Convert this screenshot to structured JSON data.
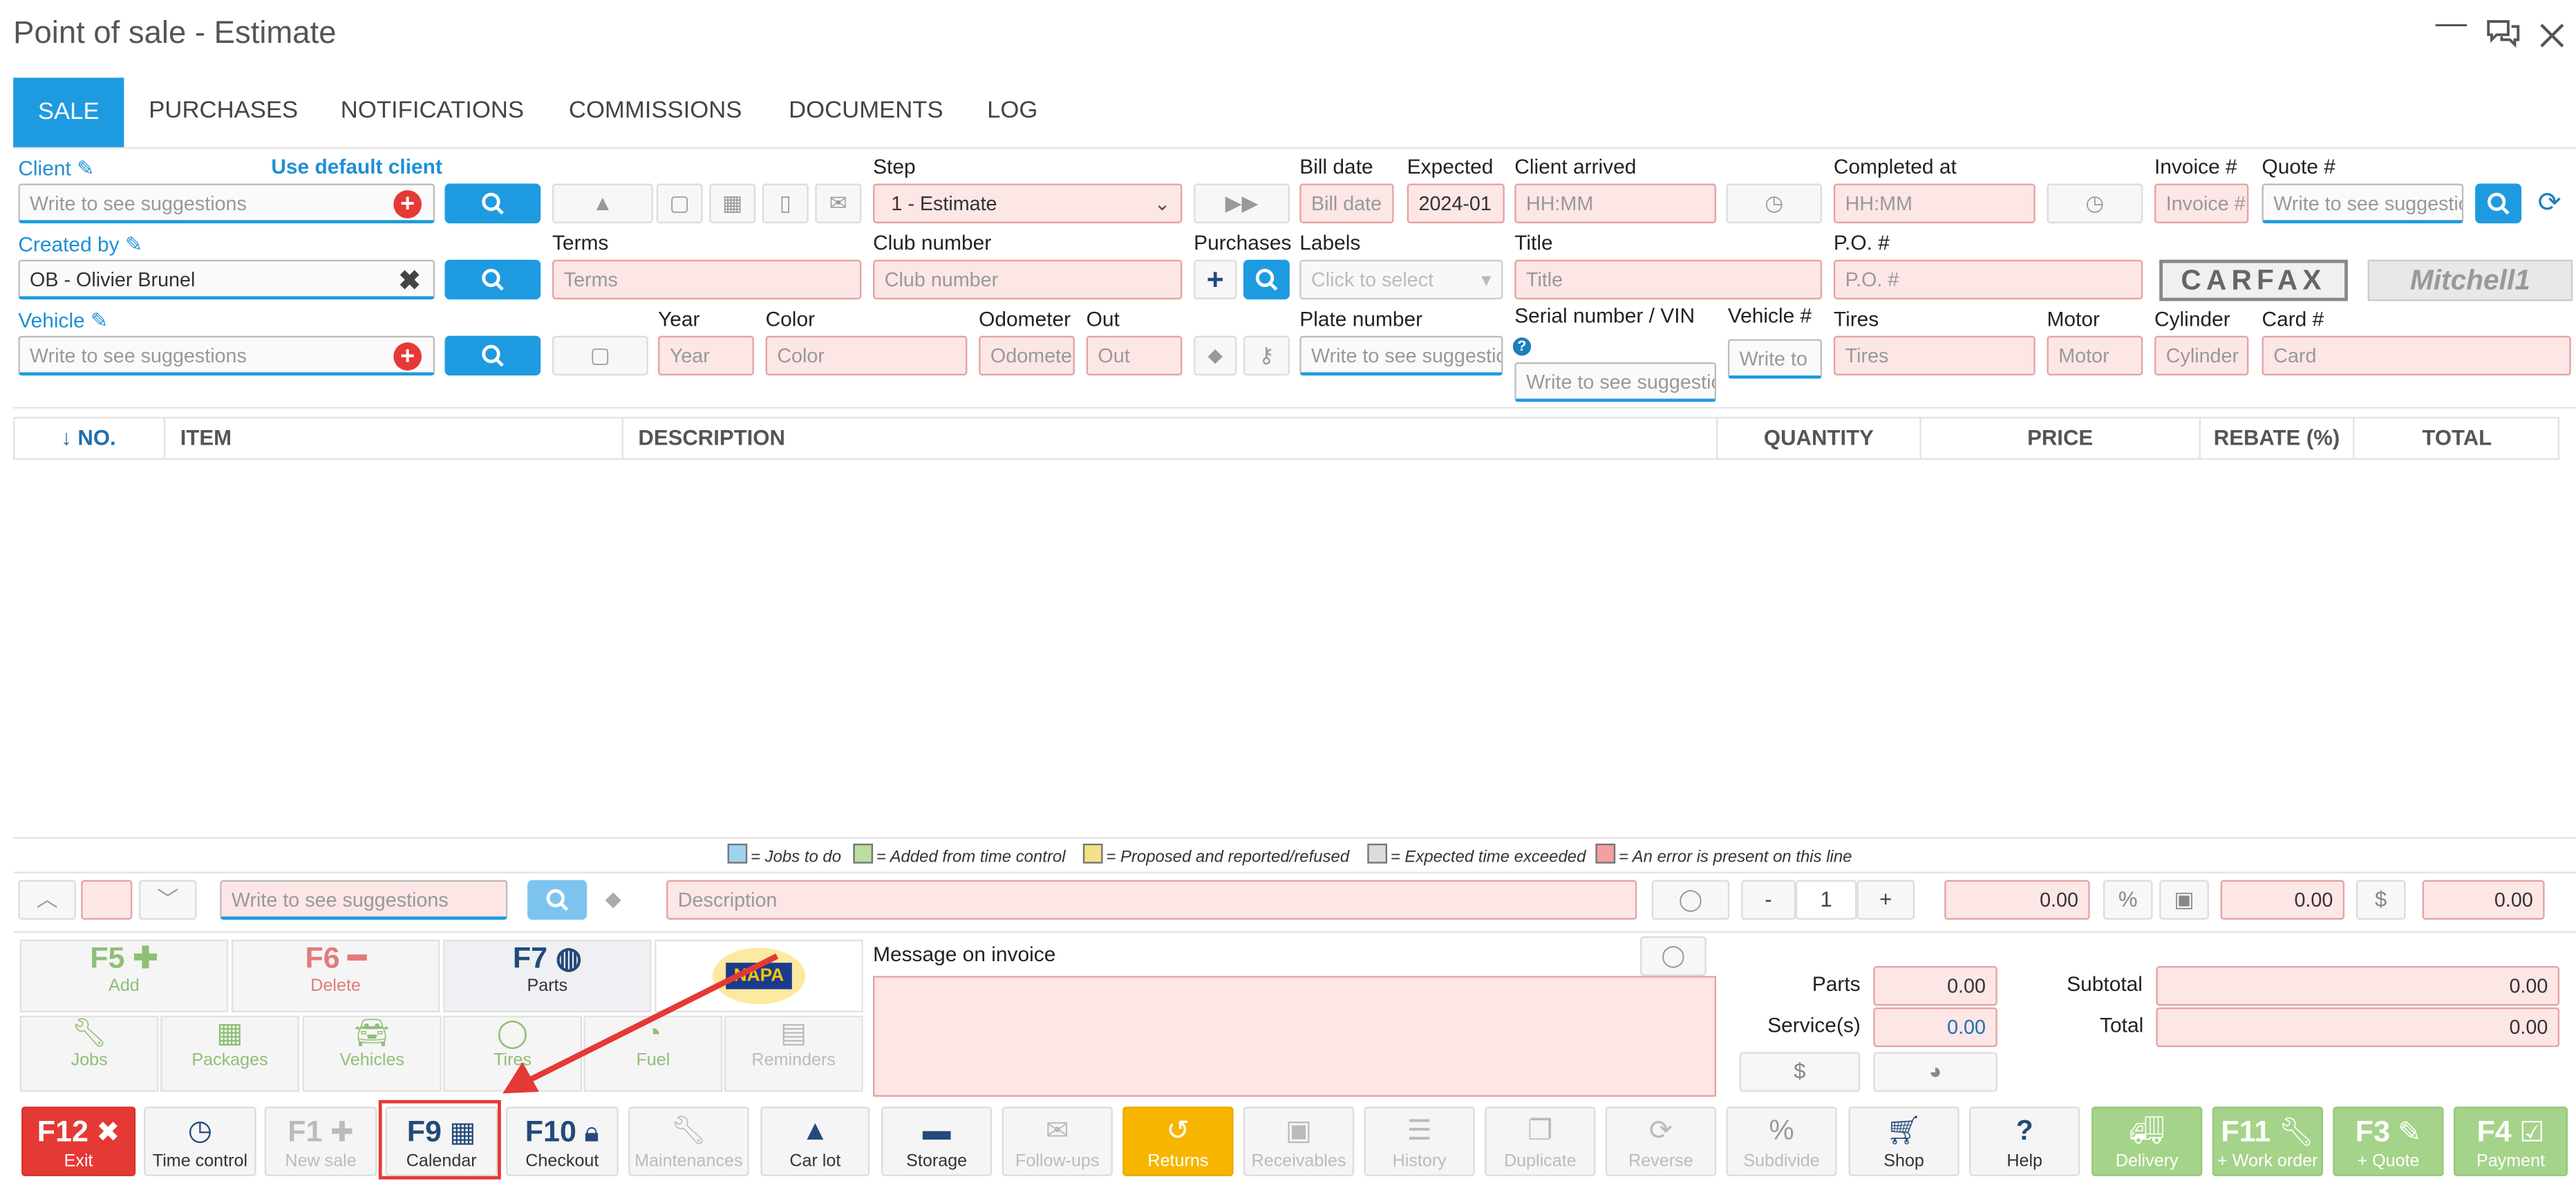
{
  "window": {
    "title": "Point of sale - Estimate"
  },
  "tabs": [
    "SALE",
    "PURCHASES",
    "NOTIFICATIONS",
    "COMMISSIONS",
    "DOCUMENTS",
    "LOG"
  ],
  "form": {
    "client_label": "Client",
    "use_default": "Use default client",
    "client_placeholder": "Write to see suggestions",
    "created_by_label": "Created by",
    "created_by_value": "OB - Olivier Brunel",
    "vehicle_label": "Vehicle",
    "vehicle_placeholder": "Write to see suggestions",
    "step_label": "Step",
    "step_value": "1 - Estimate",
    "terms_label": "Terms",
    "terms_placeholder": "Terms",
    "club_label": "Club number",
    "club_placeholder": "Club number",
    "purchases_label": "Purchases",
    "year_label": "Year",
    "year_placeholder": "Year",
    "color_label": "Color",
    "color_placeholder": "Color",
    "odometer_label": "Odometer",
    "odometer_placeholder": "Odometer",
    "out_label": "Out",
    "out_placeholder": "Out",
    "bill_date_label": "Bill date",
    "bill_date_placeholder": "Bill date",
    "expected_label": "Expected",
    "expected_value": "2024-01",
    "client_arrived_label": "Client arrived",
    "client_arrived_placeholder": "HH:MM",
    "completed_label": "Completed at",
    "completed_placeholder": "HH:MM",
    "invoice_label": "Invoice #",
    "invoice_placeholder": "Invoice #",
    "quote_label": "Quote #",
    "quote_placeholder": "Write to see suggestions",
    "labels_label": "Labels",
    "labels_placeholder": "Click to select",
    "title_label": "Title",
    "title_placeholder": "Title",
    "po_label": "P.O. #",
    "po_placeholder": "P.O. #",
    "plate_label": "Plate number",
    "plate_placeholder": "Write to see suggestions",
    "serial_label": "Serial number / VIN",
    "serial_placeholder": "Write to see suggestions",
    "vehicle_num_label": "Vehicle #",
    "vehicle_num_placeholder": "Write to",
    "tires_label": "Tires",
    "tires_placeholder": "Tires",
    "motor_label": "Motor",
    "motor_placeholder": "Motor",
    "cylinder_label": "Cylinder",
    "cylinder_placeholder": "Cylinder",
    "card_label": "Card #",
    "card_placeholder": "Card",
    "carfax": "CARFAX",
    "mitchell": "Mitchell1"
  },
  "table": {
    "headers": [
      "↓ NO.",
      "ITEM",
      "DESCRIPTION",
      "QUANTITY",
      "PRICE",
      "REBATE (%)",
      "TOTAL"
    ]
  },
  "legend": [
    {
      "color": "#9ed3ee",
      "text": "= Jobs to do"
    },
    {
      "color": "#b8dea0",
      "text": "= Added from time control"
    },
    {
      "color": "#f7e08a",
      "text": "= Proposed and reported/refused"
    },
    {
      "color": "#dddddd",
      "text": "= Expected time exceeded"
    },
    {
      "color": "#f3a0a0",
      "text": "= An error is present on this line"
    }
  ],
  "entry": {
    "search_placeholder": "Write to see suggestions",
    "description_placeholder": "Description",
    "qty": "1",
    "minus": "-",
    "plus": "+",
    "price": "0.00",
    "rebate": "0.00",
    "total": "0.00"
  },
  "tiles": {
    "f5_key": "F5",
    "f5_label": "Add",
    "f6_key": "F6",
    "f6_label": "Delete",
    "f7_key": "F7",
    "f7_label": "Parts",
    "napa": "NAPA",
    "jobs": "Jobs",
    "packages": "Packages",
    "vehicles": "Vehicles",
    "tires": "Tires",
    "fuel": "Fuel",
    "reminders": "Reminders"
  },
  "message": {
    "label": "Message on invoice"
  },
  "totals": {
    "parts_label": "Parts",
    "parts_value": "0.00",
    "service_label": "Service(s)",
    "service_value": "0.00",
    "subtotal_label": "Subtotal",
    "subtotal_value": "0.00",
    "total_label": "Total",
    "total_value": "0.00"
  },
  "footer": [
    {
      "key": "F12",
      "label": "Exit"
    },
    {
      "key": "",
      "label": "Time control"
    },
    {
      "key": "F1",
      "label": "New sale"
    },
    {
      "key": "F9",
      "label": "Calendar"
    },
    {
      "key": "F10",
      "label": "Checkout"
    },
    {
      "key": "",
      "label": "Maintenances"
    },
    {
      "key": "",
      "label": "Car lot"
    },
    {
      "key": "",
      "label": "Storage"
    },
    {
      "key": "",
      "label": "Follow-ups"
    },
    {
      "key": "",
      "label": "Returns"
    },
    {
      "key": "",
      "label": "Receivables"
    },
    {
      "key": "",
      "label": "History"
    },
    {
      "key": "",
      "label": "Duplicate"
    },
    {
      "key": "",
      "label": "Reverse"
    },
    {
      "key": "",
      "label": "Subdivide"
    },
    {
      "key": "",
      "label": "Shop"
    },
    {
      "key": "",
      "label": "Help"
    },
    {
      "key": "",
      "label": "Delivery"
    },
    {
      "key": "F11",
      "label": "+ Work order"
    },
    {
      "key": "F3",
      "label": "+ Quote"
    },
    {
      "key": "F4",
      "label": "Payment"
    }
  ],
  "colors": {
    "accent": "#1e9be0",
    "danger": "#e53935",
    "returns": "#f7b500",
    "green": "#a5d38a",
    "highlight": "#e53935"
  }
}
